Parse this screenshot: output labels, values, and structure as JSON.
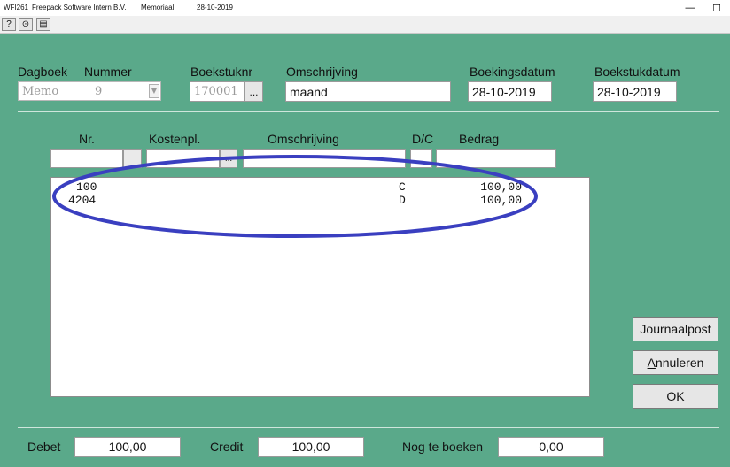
{
  "window": {
    "code": "WFI261",
    "company": "Freepack Software Intern B.V.",
    "module": "Memoriaal",
    "date": "28-10-2019",
    "minimize_icon": "minimize-icon",
    "maximize_icon": "maximize-icon"
  },
  "toolbar": {
    "items": [
      {
        "icon": "help-icon",
        "glyph": "?"
      },
      {
        "icon": "binoculars-icon",
        "glyph": "⊙"
      },
      {
        "icon": "print-icon",
        "glyph": "▤"
      }
    ]
  },
  "header": {
    "dagboek_label": "Dagboek",
    "nummer_label": "Nummer",
    "dagboek_value": "Memo",
    "nummer_value": "9",
    "boekstuknr_label": "Boekstuknr",
    "boekstuknr_value": "170001",
    "browse_label": "...",
    "omschrijving_label": "Omschrijving",
    "omschrijving_value": "maand",
    "boekingsdatum_label": "Boekingsdatum",
    "boekingsdatum_value": "28-10-2019",
    "boekstukdatum_label": "Boekstukdatum",
    "boekstukdatum_value": "28-10-2019"
  },
  "lines": {
    "col_nr": "Nr.",
    "col_kostenpl": "Kostenpl.",
    "col_omschrijving": "Omschrijving",
    "col_dc": "D/C",
    "col_bedrag": "Bedrag",
    "browse_label": "...",
    "rows": [
      {
        "nr": "100",
        "dc": "C",
        "bedrag": "100,00"
      },
      {
        "nr": "4204",
        "dc": "D",
        "bedrag": "100,00"
      }
    ]
  },
  "buttons": {
    "journaalpost": "Journaalpost",
    "annuleren_u": "A",
    "annuleren_rest": "nnuleren",
    "ok_u": "O",
    "ok_rest": "K"
  },
  "totals": {
    "debet_label": "Debet",
    "debet_value": "100,00",
    "credit_label": "Credit",
    "credit_value": "100,00",
    "nog_label": "Nog te boeken",
    "nog_value": "0,00"
  },
  "colors": {
    "background": "#5aa98a",
    "highlight_ellipse": "#3a3fc0"
  }
}
